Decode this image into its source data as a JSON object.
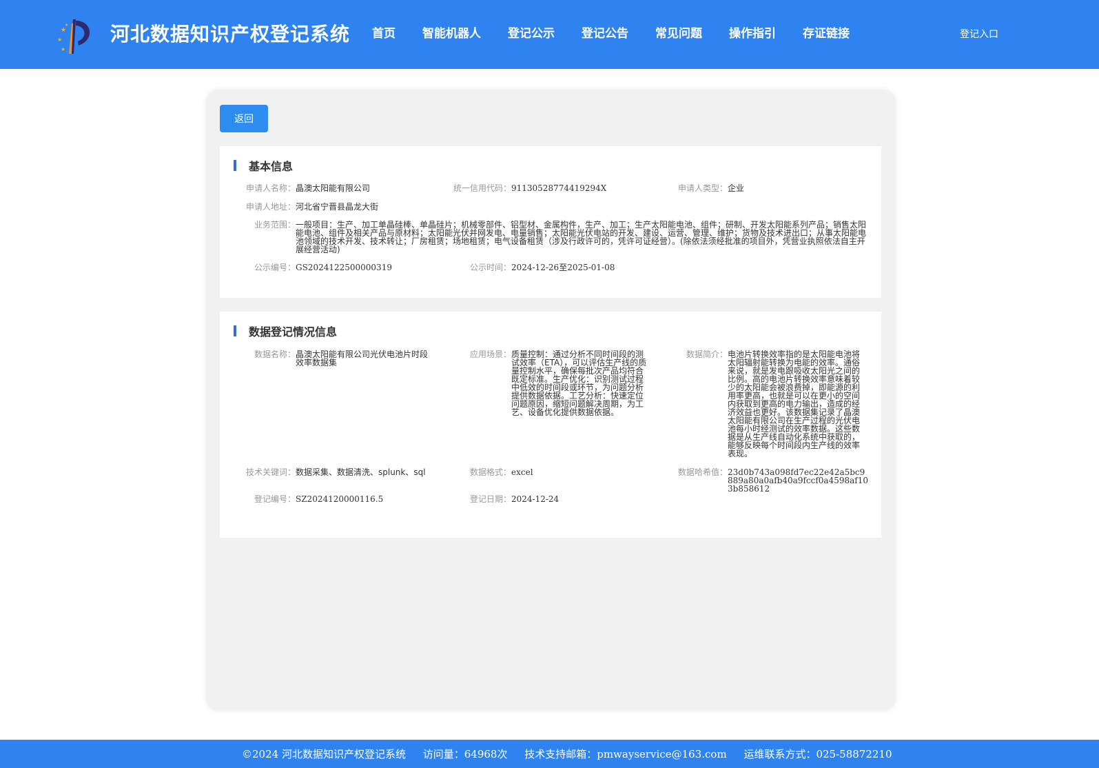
{
  "header": {
    "site_title": "河北数据知识产权登记系统",
    "nav": [
      "首页",
      "智能机器人",
      "登记公示",
      "登记公告",
      "常见问题",
      "操作指引",
      "存证链接"
    ],
    "login_label": "登记入口",
    "bg_color": "#2f83f0"
  },
  "back_label": "返回",
  "basic": {
    "title": "基本信息",
    "applicant_name_label": "申请人名称：",
    "applicant_name": "晶澳太阳能有限公司",
    "credit_code_label": "统一信用代码：",
    "credit_code": "91130528774419294X",
    "applicant_type_label": "申请人类型：",
    "applicant_type": "企业",
    "address_label": "申请人地址：",
    "address": "河北省宁晋县晶龙大街",
    "scope_label": "业务范围：",
    "scope": "一般项目：生产、加工单晶硅棒、单晶硅片；机械零部件、铝型材、金属构件，生产、加工；生产太阳能电池、组件；研制、开发太阳能系列产品；销售太阳能电池、组件及相关产品与原材料；太阳能光伏并网发电、电量销售；太阳能光伏电站的开发、建设、运营、管理、维护；货物及技术进出口；从事太阳能电池领域的技术开发、技术转让；厂房租赁；场地租赁；电气设备租赁（涉及行政许可的，凭许可证经营）。(除依法须经批准的项目外，凭营业执照依法自主开展经营活动)",
    "public_no_label": "公示编号：",
    "public_no": "GS2024122500000319",
    "public_time_label": "公示时间：",
    "public_time": "2024-12-26至2025-01-08"
  },
  "data_reg": {
    "title": "数据登记情况信息",
    "data_name_label": "数据名称：",
    "data_name": "晶澳太阳能有限公司光伏电池片时段效率数据集",
    "scene_label": "应用场景：",
    "scene": "质量控制：通过分析不同时间段的测试效率（ETA），可以评估生产线的质量控制水平，确保每批次产品均符合既定标准。生产优化：识别测试过程中低效的时间段或环节，为问题分析提供数据依据。工艺分析：快速定位问题原因，缩短问题解决周期，为工艺、设备优化提供数据依据。",
    "intro_label": "数据简介：",
    "intro": "电池片转换效率指的是太阳能电池将太阳辐射能转换为电能的效率。通俗来说，就是发电跟吸收太阳光之间的比例。高的电池片转换效率意味着较少的太阳能会被浪费掉，即能源的利用率更高，也就是可以在更小的空间内获取到更高的电力输出，造成的经济效益也更好。该数据集记录了晶澳太阳能有限公司在生产过程的光伏电池每小时经测试的效率数据。这些数据是从生产线自动化系统中获取的，能够反映每个时间段内生产线的效率表现。",
    "keywords_label": "技术关键词：",
    "keywords": "数据采集、数据清洗、splunk、sql",
    "format_label": "数据格式：",
    "format": "excel",
    "hash_label": "数据哈希值：",
    "hash": "23d0b743a098fd7ec22e42a5bc9889a80a0afb40a9fccf0a4598af103b858612",
    "reg_no_label": "登记编号：",
    "reg_no": "SZ2024120000116.5",
    "reg_date_label": "登记日期：",
    "reg_date": "2024-12-24"
  },
  "footer": {
    "copyright": "©2024 河北数据知识产权登记系统",
    "visits": "访问量：64968次",
    "email": "技术支持邮箱：pmwayservice@163.com",
    "phone": "运维联系方式：025-58872210"
  }
}
